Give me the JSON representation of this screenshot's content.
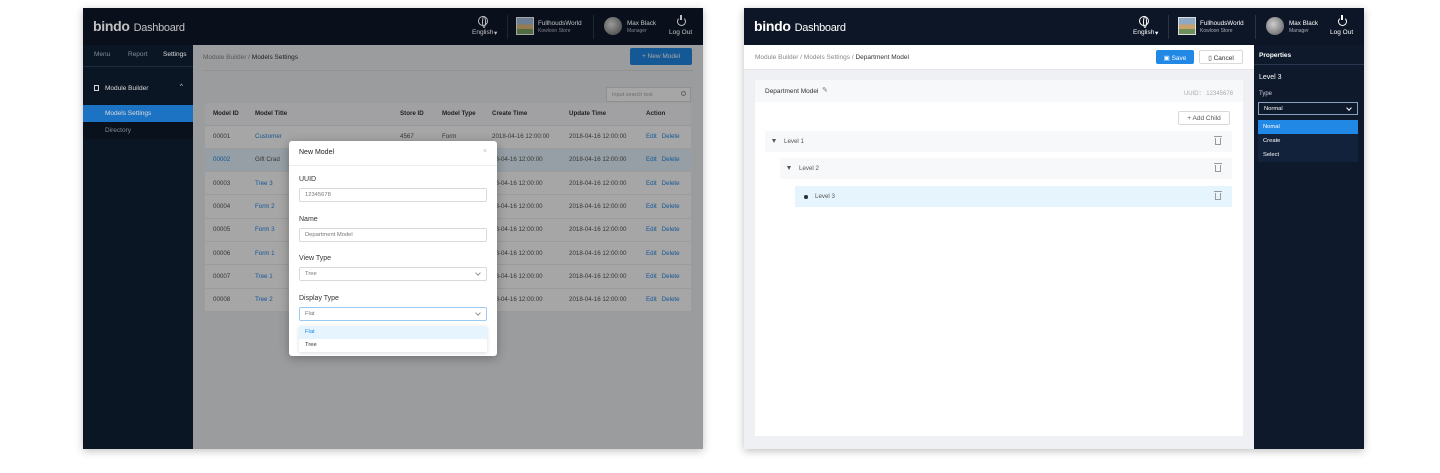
{
  "brand": {
    "logo": "bindo",
    "dashboard": "Dashboard"
  },
  "header": {
    "language": "English",
    "store_name": "FullhoudsWorld",
    "store_sub": "Kowloon Store",
    "user_name": "Max Black",
    "user_role": "Manager",
    "logout": "Log Out"
  },
  "left": {
    "tabs": [
      "Menu",
      "Report",
      "Settings"
    ],
    "section": "Module Builder",
    "items": [
      "Models Settings",
      "Directory"
    ],
    "breadcrumb": [
      "Module Builder",
      "Models Settings"
    ],
    "new_model_button": "New Model",
    "search_placeholder": "Input search text",
    "table": {
      "headers": [
        "Model ID",
        "Model Title",
        "Store ID",
        "Model Type",
        "Create Time",
        "Update Time",
        "Action"
      ],
      "rows": [
        {
          "id": "00001",
          "title": "Customer",
          "store": "4567",
          "type": "Form",
          "create": "2018-04-16 12:00:00",
          "update": "2018-04-16 12:00:00"
        },
        {
          "id": "00002",
          "title": "Gift Crad",
          "store": "",
          "type": "",
          "create": "18-04-16 12:00:00",
          "update": "2018-04-16 12:00:00"
        },
        {
          "id": "00003",
          "title": "Tree 3",
          "store": "",
          "type": "",
          "create": "18-04-16 12:00:00",
          "update": "2018-04-16 12:00:00"
        },
        {
          "id": "00004",
          "title": "Form 2",
          "store": "",
          "type": "",
          "create": "18-04-16 12:00:00",
          "update": "2018-04-16 12:00:00"
        },
        {
          "id": "00005",
          "title": "Form 3",
          "store": "",
          "type": "",
          "create": "18-04-16 12:00:00",
          "update": "2018-04-16 12:00:00"
        },
        {
          "id": "00006",
          "title": "Form 1",
          "store": "",
          "type": "",
          "create": "18-04-16 12:00:00",
          "update": "2018-04-16 12:00:00"
        },
        {
          "id": "00007",
          "title": "Tree 1",
          "store": "",
          "type": "",
          "create": "18-04-16 12:00:00",
          "update": "2018-04-16 12:00:00"
        },
        {
          "id": "00008",
          "title": "Tree 2",
          "store": "",
          "type": "",
          "create": "18-04-16 12:00:00",
          "update": "2018-04-16 12:00:00"
        }
      ],
      "edit": "Edit",
      "delete": "Delete"
    },
    "modal": {
      "title": "New Model",
      "close": "×",
      "uuid_label": "UUID",
      "uuid_value": "12345678",
      "name_label": "Name",
      "name_value": "Department Model",
      "view_type_label": "View Type",
      "view_type_value": "Tree",
      "display_type_label": "Display Type",
      "display_type_value": "Flat",
      "display_options": [
        "Flat",
        "Tree"
      ]
    }
  },
  "right": {
    "breadcrumb_a": "Module Builder",
    "breadcrumb_b": "Models Settings",
    "breadcrumb_c": "Department Model",
    "save": "Save",
    "cancel": "Cancel",
    "model_name": "Department Model",
    "uuid": "UUID： 12345678",
    "add_child": "Add Child",
    "levels": [
      "Level 1",
      "Level 2",
      "Level 3"
    ],
    "properties": {
      "title": "Properties",
      "selected": "Level 3",
      "type_label": "Type",
      "type_value": "Normal",
      "options": [
        "Nomal",
        "Create",
        "Select"
      ]
    }
  },
  "colors": {
    "accent": "#2188e6",
    "navy": "#0d1626",
    "sidebar": "#0e1a2b",
    "highlight": "#e6f5fd"
  }
}
